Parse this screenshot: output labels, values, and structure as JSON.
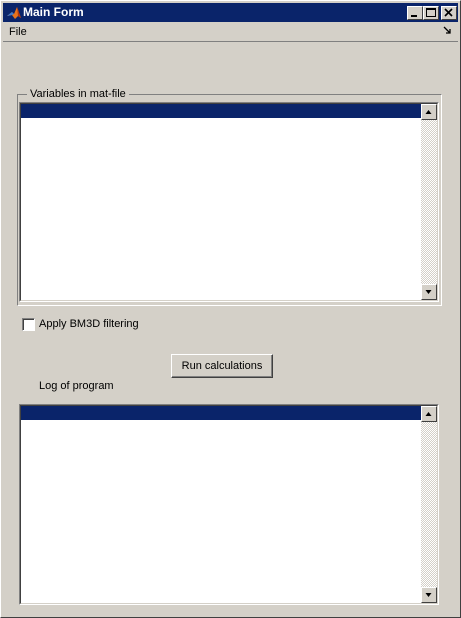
{
  "window": {
    "title": "Main Form",
    "controls": {
      "minimize": "minimize-icon",
      "maximize": "maximize-icon",
      "close": "close-icon"
    }
  },
  "menubar": {
    "items": [
      {
        "label": "File"
      }
    ],
    "dock_icon": "undock-arrow-icon"
  },
  "variables_panel": {
    "title": "Variables in mat-file",
    "items": [
      ""
    ],
    "selected_index": 0
  },
  "bm3d": {
    "label": "Apply BM3D filtering",
    "checked": false
  },
  "run_button": {
    "label": "Run calculations"
  },
  "log": {
    "label": "Log of program",
    "items": [
      ""
    ],
    "selected_index": 0
  },
  "colors": {
    "titlebar": "#0a246a",
    "face": "#d4d0c8",
    "selection": "#0a246a",
    "list_bg": "#ffffff"
  }
}
